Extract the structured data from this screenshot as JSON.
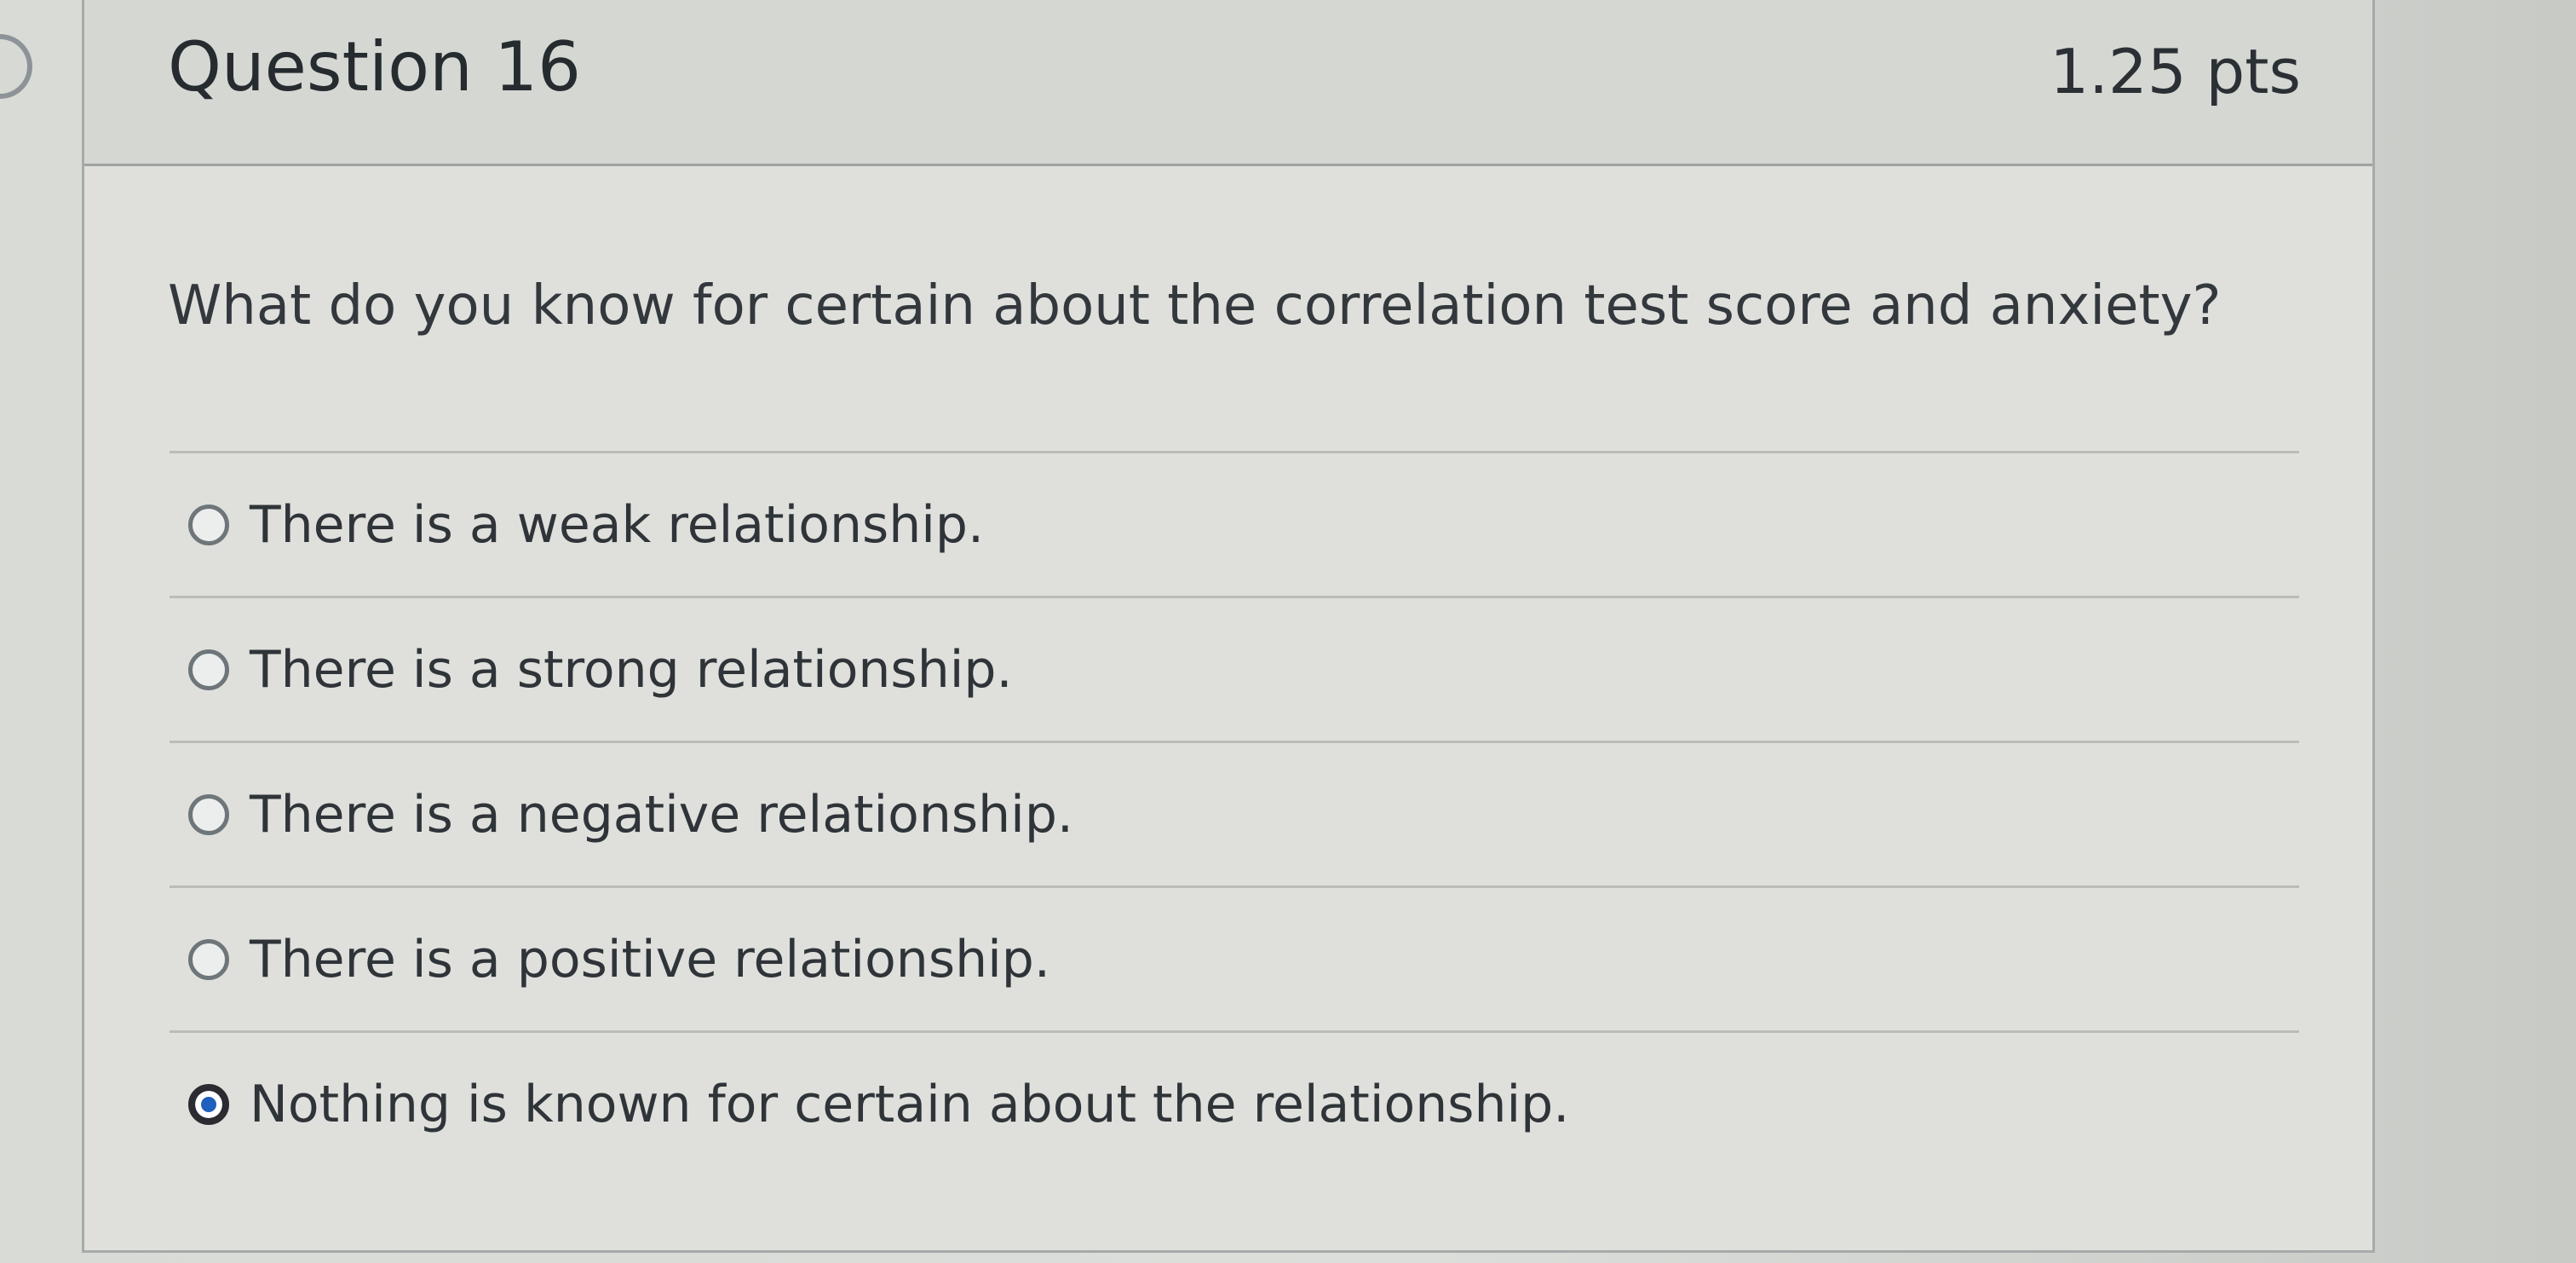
{
  "question": {
    "title": "Question 16",
    "points": "1.25 pts",
    "prompt": "What do you know for certain about the correlation test score and anxiety?"
  },
  "answers": [
    {
      "label": "There is a weak relationship.",
      "selected": false
    },
    {
      "label": "There is a strong relationship.",
      "selected": false
    },
    {
      "label": "There is a negative relationship.",
      "selected": false
    },
    {
      "label": "There is a positive relationship.",
      "selected": false
    },
    {
      "label": "Nothing is known for certain about the relationship.",
      "selected": true
    }
  ],
  "colors": {
    "selected_radio": "#1f5fbd"
  }
}
